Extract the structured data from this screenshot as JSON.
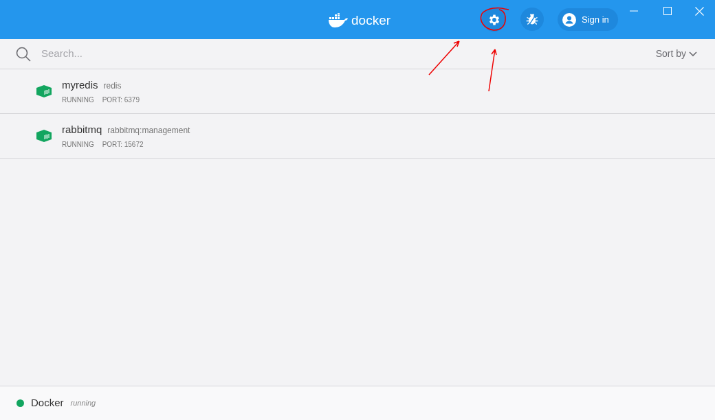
{
  "header": {
    "logo_text": "docker",
    "sign_in": "Sign in"
  },
  "search": {
    "placeholder": "Search..."
  },
  "sort": {
    "label": "Sort by"
  },
  "containers": [
    {
      "name": "myredis",
      "image": "redis",
      "status": "RUNNING",
      "port": "PORT: 6379"
    },
    {
      "name": "rabbitmq",
      "image": "rabbitmq:management",
      "status": "RUNNING",
      "port": "PORT: 15672"
    }
  ],
  "footer": {
    "name": "Docker",
    "status": "running",
    "color": "#12a55f"
  }
}
